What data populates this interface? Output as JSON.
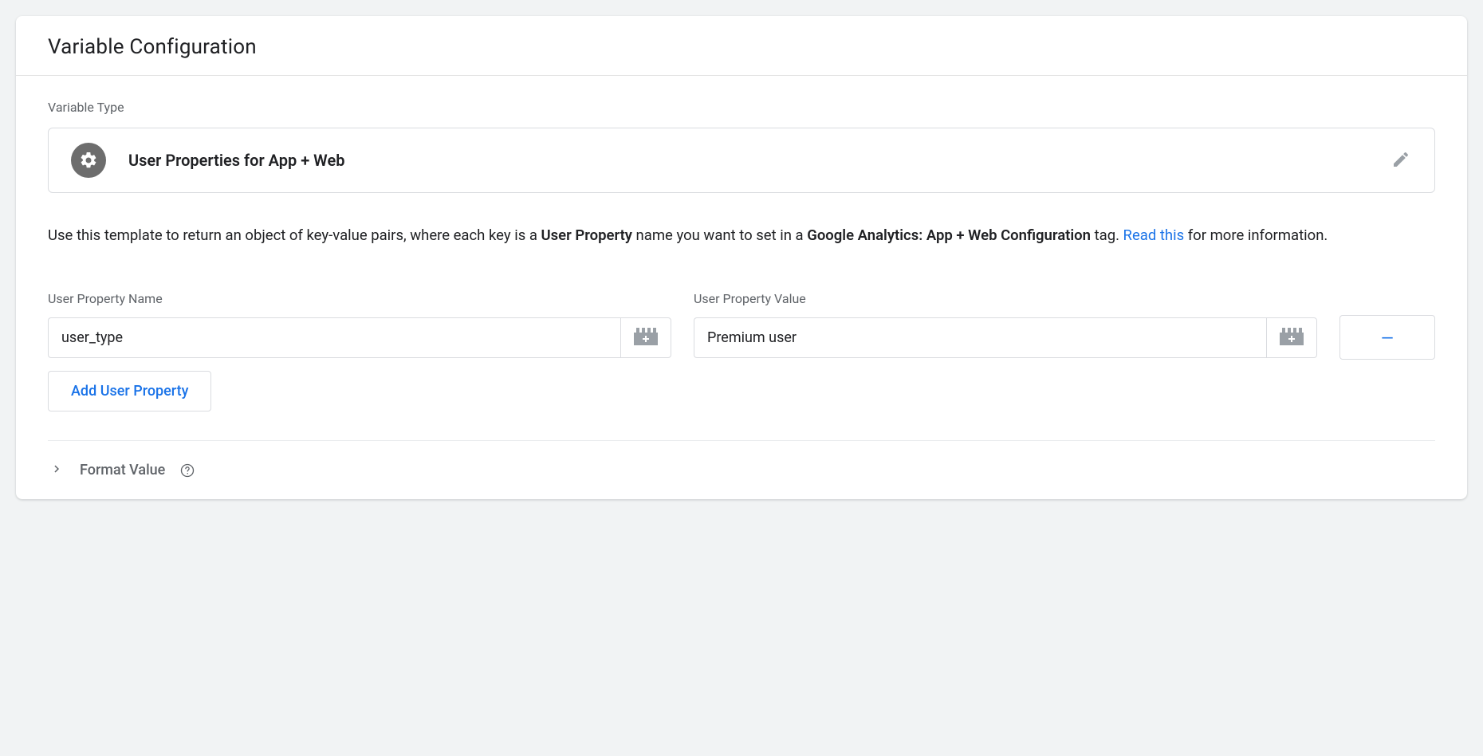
{
  "header": {
    "title": "Variable Configuration"
  },
  "variableType": {
    "label": "Variable Type",
    "name": "User Properties for App + Web"
  },
  "description": {
    "part1": "Use this template to return an object of key-value pairs, where each key is a ",
    "strong1": "User Property",
    "part2": " name you want to set in a ",
    "strong2": "Google Analytics: App + Web Configuration",
    "part3": " tag. ",
    "linkText": "Read this",
    "part4": " for more information."
  },
  "properties": {
    "nameLabel": "User Property Name",
    "valueLabel": "User Property Value",
    "rows": [
      {
        "name": "user_type",
        "value": "Premium user"
      }
    ],
    "addButton": "Add User Property",
    "removeSymbol": "–"
  },
  "formatValue": {
    "label": "Format Value"
  }
}
